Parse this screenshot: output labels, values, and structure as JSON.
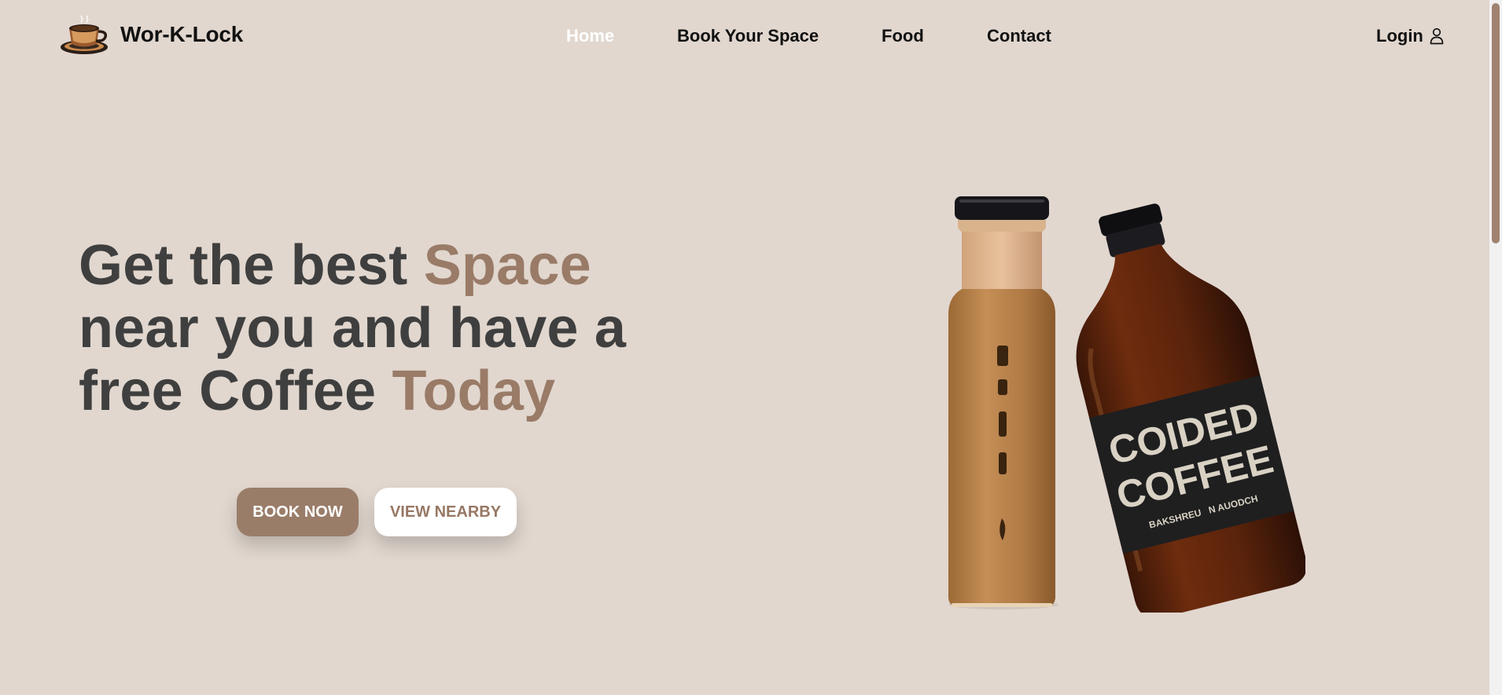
{
  "brand": {
    "name": "Wor-K-Lock",
    "logo_icon": "coffee-cup-logo-icon"
  },
  "nav": {
    "items": [
      {
        "label": "Home",
        "active": true
      },
      {
        "label": "Book Your Space",
        "active": false
      },
      {
        "label": "Food",
        "active": false
      },
      {
        "label": "Contact",
        "active": false
      }
    ],
    "login": {
      "label": "Login",
      "icon": "user-icon"
    }
  },
  "hero": {
    "title": {
      "line1_text": "Get the best ",
      "line1_accent": "Space",
      "line2_text": "near you and have a",
      "line3_text": "free Coffee ",
      "line3_accent": "Today"
    },
    "buttons": {
      "primary": "BOOK NOW",
      "secondary": "VIEW NEARBY"
    },
    "image": {
      "label_line1": "COIDED",
      "label_line2": "COFFEE",
      "label_line3": "BAKSHREU   N AUODCH"
    }
  },
  "colors": {
    "background": "#e1d7cf",
    "accent": "#997b67",
    "heading": "#3f3f3f",
    "nav_text": "#111111",
    "nav_active": "#ffffff",
    "button_primary_bg": "#9a7d69",
    "button_secondary_text": "#977764",
    "scrollbar_thumb": "#a08270"
  }
}
